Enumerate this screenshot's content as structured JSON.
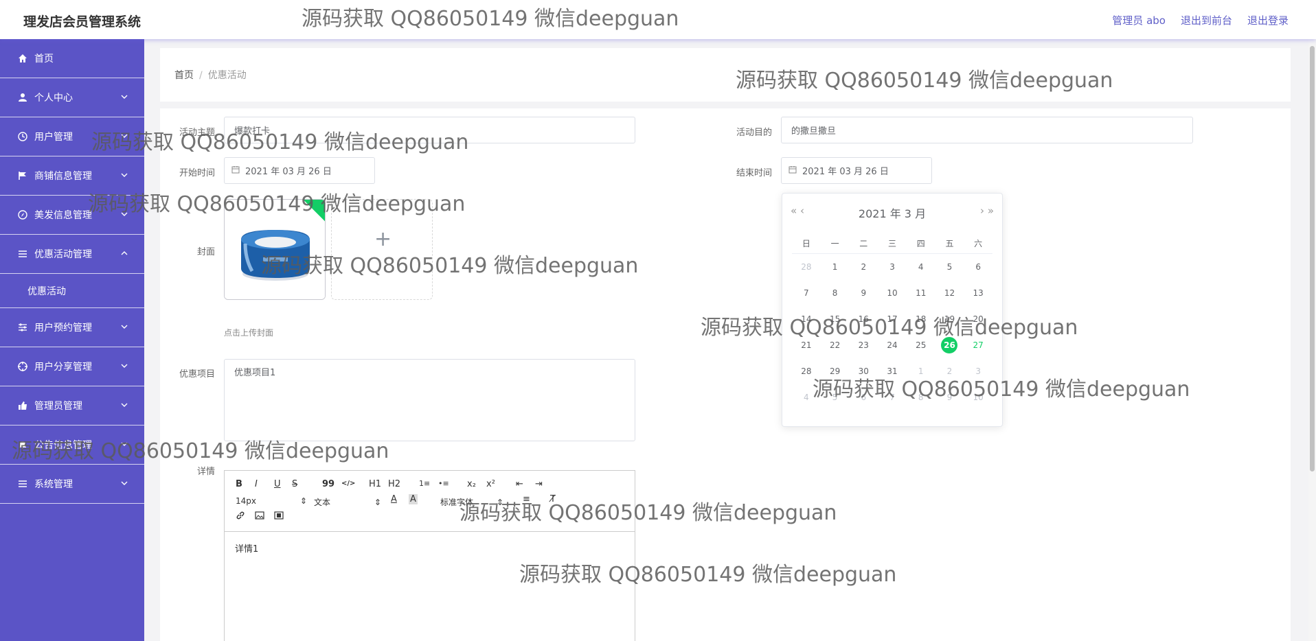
{
  "header": {
    "title": "理发店会员管理系统",
    "links": [
      "管理员 abo",
      "退出到前台",
      "退出登录"
    ]
  },
  "sidebar": {
    "items": [
      {
        "label": "首页",
        "icon": "home-icon"
      },
      {
        "label": "个人中心",
        "icon": "user-icon"
      },
      {
        "label": "用户管理",
        "icon": "clock-icon"
      },
      {
        "label": "商铺信息管理",
        "icon": "flag-icon"
      },
      {
        "label": "美发信息管理",
        "icon": "compass-icon"
      },
      {
        "label": "优惠活动管理",
        "icon": "menu-icon"
      },
      {
        "label": "用户预约管理",
        "icon": "sliders-icon"
      },
      {
        "label": "用户分享管理",
        "icon": "target-icon"
      },
      {
        "label": "管理员管理",
        "icon": "thumb-icon"
      },
      {
        "label": "公告信息管理",
        "icon": "bell-icon"
      },
      {
        "label": "系统管理",
        "icon": "menu-icon"
      }
    ],
    "sub_item": "优惠活动"
  },
  "breadcrumb": {
    "home": "首页",
    "separator": "/",
    "current": "优惠活动"
  },
  "form": {
    "theme_label": "活动主题",
    "theme_value": "爆款打卡",
    "purpose_label": "活动目的",
    "purpose_value": "的撒旦撒旦",
    "start_label": "开始时间",
    "start_value": "2021 年 03 月 26 日",
    "end_label": "结束时间",
    "end_value": "2021 年 03 月 26 日",
    "cover_label": "封面",
    "upload_tip": "点击上传封面",
    "upload_plus": "+",
    "items_label": "优惠项目",
    "items_value": "优惠项目1",
    "details_label": "详情",
    "details_value": "详情1"
  },
  "editor": {
    "font_size": "14px",
    "text_style": "文本",
    "font_family": "标准字体",
    "buttons": [
      "B",
      "I",
      "U",
      "S",
      "99",
      "</>",
      "H1",
      "H2",
      "1≡",
      "•≡",
      "x₂",
      "x²",
      "⇤",
      "⇥"
    ]
  },
  "datepicker": {
    "title": "2021 年  3 月",
    "prev": "«  ‹",
    "next": "›  »",
    "weekdays": [
      "日",
      "一",
      "二",
      "三",
      "四",
      "五",
      "六"
    ],
    "weeks": [
      [
        "28",
        "1",
        "2",
        "3",
        "4",
        "5",
        "6"
      ],
      [
        "7",
        "8",
        "9",
        "10",
        "11",
        "12",
        "13"
      ],
      [
        "14",
        "15",
        "16",
        "17",
        "18",
        "19",
        "20"
      ],
      [
        "21",
        "22",
        "23",
        "24",
        "25",
        "26",
        "27"
      ],
      [
        "28",
        "29",
        "30",
        "31",
        "1",
        "2",
        "3"
      ],
      [
        "4",
        "5",
        "6",
        "7",
        "8",
        "9",
        "10"
      ]
    ],
    "selected": "26",
    "today": "27",
    "accent": "#13ce66"
  },
  "colors": {
    "sidebar": "#5b54c6",
    "link": "#5f5fc8"
  },
  "watermark": "源码获取 QQ86050149 微信deepguan"
}
